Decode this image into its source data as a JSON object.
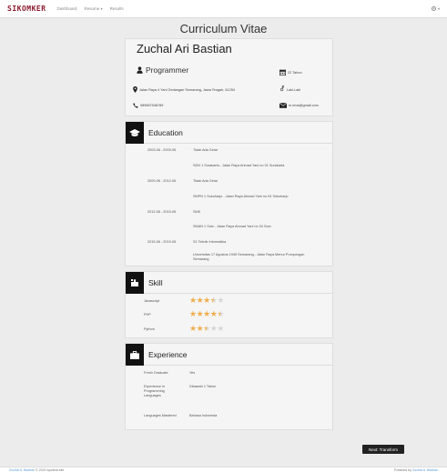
{
  "navbar": {
    "brand": "SIKOMKER",
    "links": [
      "Dashboard",
      "Resume",
      "Results"
    ],
    "resume_caret": "▾",
    "right_icon": "gear-icon",
    "right_caret": "▾"
  },
  "page_title": "Curriculum Vitae",
  "profile": {
    "name": "Zuchal Ari Bastian",
    "role": "Programmer",
    "age": "22 Tahun",
    "address": "Jalan Raya 4 Yani Gedangan Semarang, Jawa Tengah, 61254",
    "gender": "Laki-Laki",
    "phone": "089667548789",
    "email": "m.rima@gmail.com"
  },
  "education": {
    "title": "Education",
    "rows": [
      {
        "period": "2003-06 - 2009-06",
        "level": "Tidak Ada Gelar",
        "school": "SDN 1 Surakarta - Jalan Raya Ahmad Yani no 01 Surakarta"
      },
      {
        "period": "2009-06 - 2012-06",
        "level": "Tidak Ada Gelar",
        "school": "SMPN 1 Sukoharjo - Jalan Raya Ahmad Yani no 04 Sukoharjo"
      },
      {
        "period": "2012-06 - 2015-06",
        "level": "SMK",
        "school": "SMAN 1 Solo - Jalan Raya Ahmad Yani no 34 Solo"
      },
      {
        "period": "2015-06 - 2019-06",
        "level": "S1 Teknik Informatika",
        "school": "Universitas 17 Agustus 1945 Semarang - Jalan Raya Menur Pumpungan Semarang"
      }
    ]
  },
  "skill": {
    "title": "Skill",
    "items": [
      {
        "name": "Javascript",
        "rating": 3.5,
        "max": 5
      },
      {
        "name": "PHP",
        "rating": 4.5,
        "max": 5
      },
      {
        "name": "Python",
        "rating": 2.5,
        "max": 5
      }
    ]
  },
  "experience": {
    "title": "Experience",
    "rows": [
      {
        "label": "Fresh Graduate",
        "value": "Yes"
      },
      {
        "label": "Experience in Programming Languages",
        "value": "Dibawah 1 Tahun"
      },
      {
        "label": "Languages Mastered",
        "value": "Bahasa Indonesia"
      }
    ]
  },
  "next_button": "Next: Transform",
  "footer": {
    "left_link": "Zuchal A. Bastian",
    "left_text": "© 2020 sysdeal.site",
    "right_text": "Powered by",
    "right_link": "Zuchal A. Bastian"
  },
  "colors": {
    "brand": "#8a1a2e",
    "star_on": "#f0ad4e",
    "star_off": "#d6d6d6",
    "section_icon_bg": "#111111",
    "button_bg": "#222222",
    "link": "#5b9bd5"
  }
}
